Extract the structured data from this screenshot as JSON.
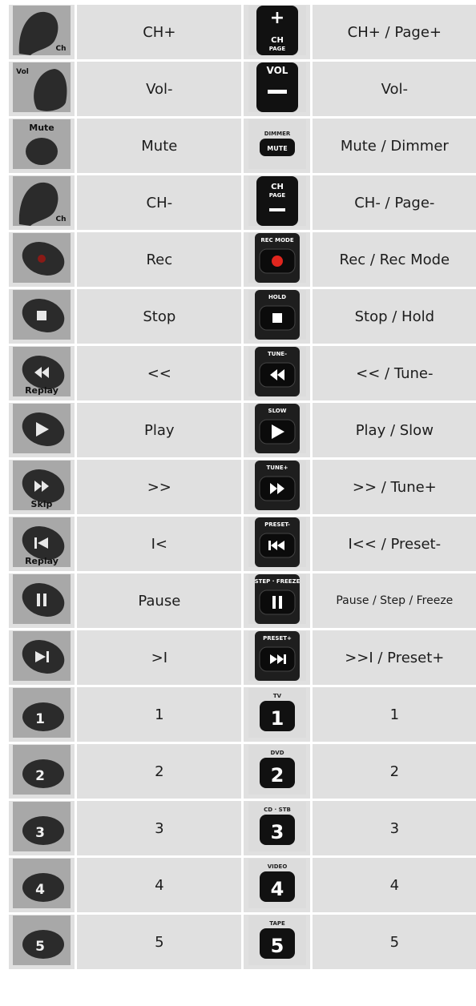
{
  "rows": [
    {
      "old": {
        "label": "CH+",
        "icon": "ch-up-rocker-button-icon",
        "caption": "Ch"
      },
      "new": {
        "label": "CH+ / Page+",
        "icon": "ch-plus-page-button-icon",
        "caption_top": "+",
        "caption_a": "CH",
        "caption_b": "PAGE"
      }
    },
    {
      "old": {
        "label": "Vol-",
        "icon": "vol-down-rocker-button-icon",
        "caption": "Vol"
      },
      "new": {
        "label": "Vol-",
        "icon": "vol-minus-button-icon",
        "caption": "VOL"
      }
    },
    {
      "old": {
        "label": "Mute",
        "icon": "mute-button-icon",
        "caption": "Mute"
      },
      "new": {
        "label": "Mute / Dimmer",
        "icon": "mute-dimmer-button-icon",
        "caption_top": "DIMMER",
        "caption": "MUTE"
      }
    },
    {
      "old": {
        "label": "CH-",
        "icon": "ch-down-rocker-button-icon",
        "caption": "Ch"
      },
      "new": {
        "label": "CH- / Page-",
        "icon": "ch-minus-page-button-icon",
        "caption_a": "CH",
        "caption_b": "PAGE"
      }
    },
    {
      "old": {
        "label": "Rec",
        "icon": "record-button-icon"
      },
      "new": {
        "label": "Rec / Rec Mode",
        "icon": "rec-mode-button-icon",
        "caption": "REC MODE"
      }
    },
    {
      "old": {
        "label": "Stop",
        "icon": "stop-button-icon"
      },
      "new": {
        "label": "Stop / Hold",
        "icon": "stop-hold-button-icon",
        "caption": "HOLD"
      }
    },
    {
      "old": {
        "label": "<<",
        "icon": "rewind-replay-button-icon",
        "caption": "Replay"
      },
      "new": {
        "label": "<< / Tune-",
        "icon": "rewind-tune-minus-button-icon",
        "caption": "TUNE-"
      }
    },
    {
      "old": {
        "label": "Play",
        "icon": "play-button-icon"
      },
      "new": {
        "label": "Play / Slow",
        "icon": "play-slow-button-icon",
        "caption": "SLOW"
      }
    },
    {
      "old": {
        "label": ">>",
        "icon": "fast-forward-skip-button-icon",
        "caption": "Skip"
      },
      "new": {
        "label": ">> / Tune+",
        "icon": "fast-forward-tune-plus-button-icon",
        "caption": "TUNE+"
      }
    },
    {
      "old": {
        "label": "I<",
        "icon": "skip-back-button-icon",
        "caption": "Replay"
      },
      "new": {
        "label": "I<< / Preset-",
        "icon": "skip-back-preset-minus-button-icon",
        "caption": "PRESET-"
      }
    },
    {
      "old": {
        "label": "Pause",
        "icon": "pause-button-icon"
      },
      "new": {
        "label": "Pause / Step / Freeze",
        "icon": "pause-step-freeze-button-icon",
        "caption": "STEP · FREEZE",
        "small": true
      }
    },
    {
      "old": {
        "label": ">I",
        "icon": "skip-forward-button-icon"
      },
      "new": {
        "label": ">>I / Preset+",
        "icon": "skip-forward-preset-plus-button-icon",
        "caption": "PRESET+"
      }
    },
    {
      "old": {
        "label": "1",
        "icon": "number-1-button-icon",
        "digit": "1"
      },
      "new": {
        "label": "1",
        "icon": "number-1-tv-button-icon",
        "digit": "1",
        "caption": "TV"
      }
    },
    {
      "old": {
        "label": "2",
        "icon": "number-2-button-icon",
        "digit": "2"
      },
      "new": {
        "label": "2",
        "icon": "number-2-dvd-button-icon",
        "digit": "2",
        "caption": "DVD"
      }
    },
    {
      "old": {
        "label": "3",
        "icon": "number-3-button-icon",
        "digit": "3"
      },
      "new": {
        "label": "3",
        "icon": "number-3-cd-stb-button-icon",
        "digit": "3",
        "caption": "CD · STB"
      }
    },
    {
      "old": {
        "label": "4",
        "icon": "number-4-button-icon",
        "digit": "4"
      },
      "new": {
        "label": "4",
        "icon": "number-4-video-button-icon",
        "digit": "4",
        "caption": "VIDEO"
      }
    },
    {
      "old": {
        "label": "5",
        "icon": "number-5-button-icon",
        "digit": "5"
      },
      "new": {
        "label": "5",
        "icon": "number-5-tape-button-icon",
        "digit": "5",
        "caption": "TAPE"
      }
    }
  ],
  "colors": {
    "cell_bg": "#e0e0e0",
    "old_remote_bg": "#a8a8a8",
    "new_remote_bg": "#dcdcdc",
    "button_dark": "#2b2b2b",
    "button_black": "#111111",
    "rec_red": "#e0261e"
  }
}
